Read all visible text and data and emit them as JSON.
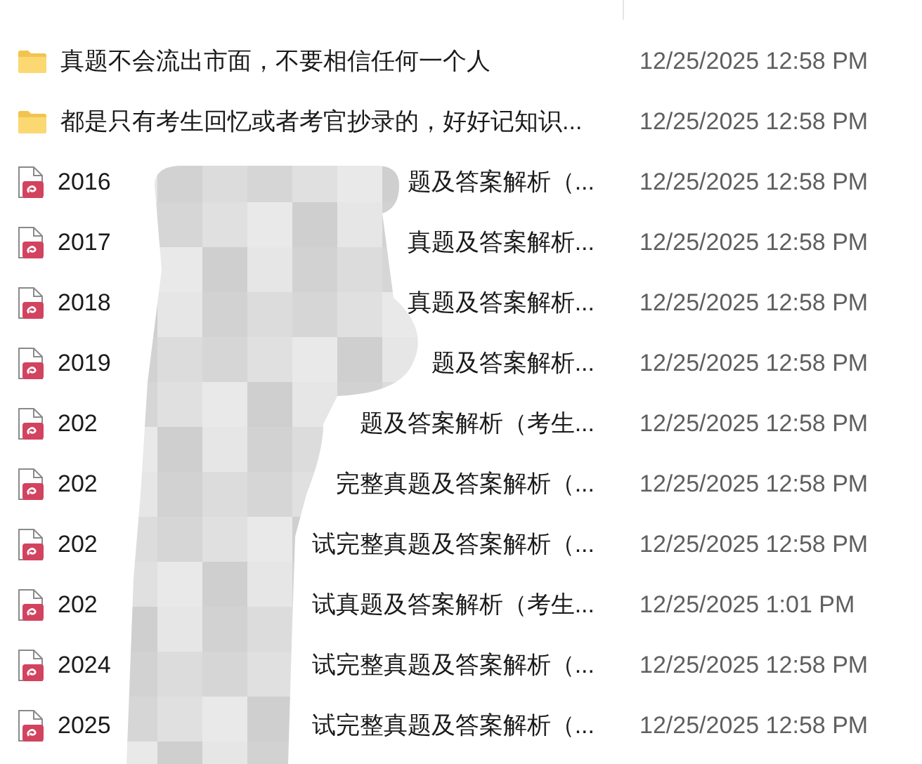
{
  "files": [
    {
      "kind": "folder",
      "name": "真题不会流出市面，不要相信任何一个人",
      "modified": "12/25/2025 12:58 PM"
    },
    {
      "kind": "folder",
      "name": "都是只有考生回忆或者考官抄录的，好好记知识...",
      "modified": "12/25/2025 12:58 PM"
    },
    {
      "kind": "pdf",
      "name_start": "2016",
      "name_end": "题及答案解析（...",
      "modified": "12/25/2025 12:58 PM"
    },
    {
      "kind": "pdf",
      "name_start": "2017",
      "name_end": "真题及答案解析...",
      "modified": "12/25/2025 12:58 PM"
    },
    {
      "kind": "pdf",
      "name_start": "2018",
      "name_end": "真题及答案解析...",
      "modified": "12/25/2025 12:58 PM"
    },
    {
      "kind": "pdf",
      "name_start": "2019",
      "name_end": "题及答案解析...",
      "modified": "12/25/2025 12:58 PM"
    },
    {
      "kind": "pdf",
      "name_start": "202",
      "name_end": "题及答案解析（考生...",
      "modified": "12/25/2025 12:58 PM"
    },
    {
      "kind": "pdf",
      "name_start": "202",
      "name_end": "完整真题及答案解析（...",
      "modified": "12/25/2025 12:58 PM"
    },
    {
      "kind": "pdf",
      "name_start": "202",
      "name_end": "试完整真题及答案解析（...",
      "modified": "12/25/2025 12:58 PM"
    },
    {
      "kind": "pdf",
      "name_start": "202",
      "name_end": "试真题及答案解析（考生...",
      "modified": "12/25/2025 1:01 PM"
    },
    {
      "kind": "pdf",
      "name_start": "2024",
      "name_end": "试完整真题及答案解析（...",
      "modified": "12/25/2025 12:58 PM"
    },
    {
      "kind": "pdf",
      "name_start": "2025",
      "name_end": "试完整真题及答案解析（...",
      "modified": "12/25/2025 12:58 PM"
    }
  ]
}
